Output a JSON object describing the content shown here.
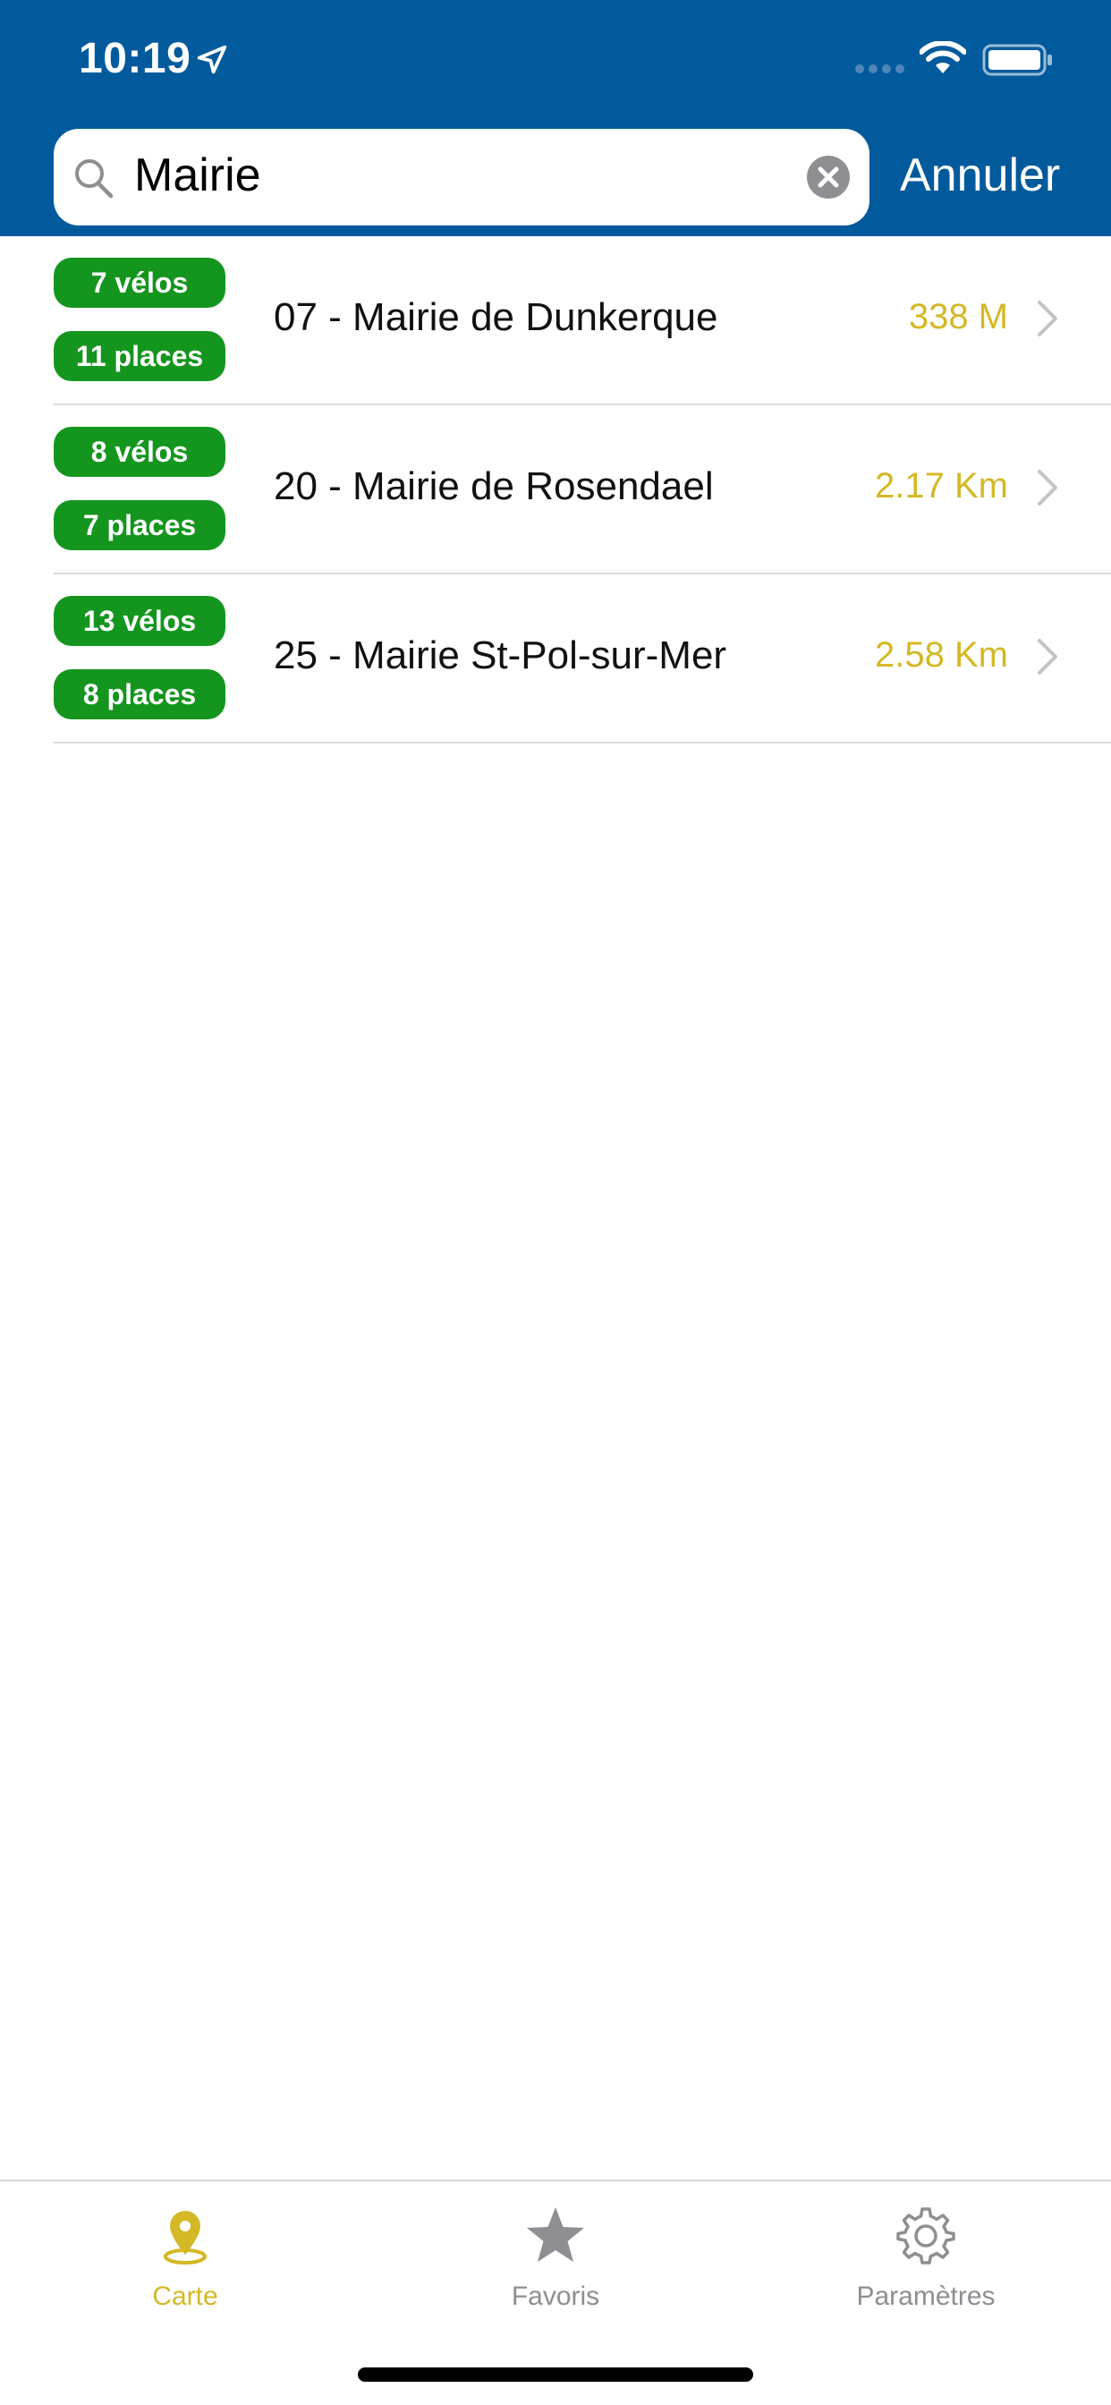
{
  "status_bar": {
    "time": "10:19"
  },
  "search": {
    "query": "Mairie",
    "cancel_label": "Annuler"
  },
  "stations": [
    {
      "bikes": "7 vélos",
      "places": "11 places",
      "name": "07 - Mairie de Dunkerque",
      "distance": "338 M"
    },
    {
      "bikes": "8 vélos",
      "places": "7 places",
      "name": "20 - Mairie de Rosendael",
      "distance": "2.17 Km"
    },
    {
      "bikes": "13 vélos",
      "places": "8 places",
      "name": "25 - Mairie St-Pol-sur-Mer",
      "distance": "2.58 Km"
    }
  ],
  "tabbar": {
    "tabs": [
      {
        "label": "Carte",
        "icon": "map-pin-icon",
        "active": true
      },
      {
        "label": "Favoris",
        "icon": "star-icon",
        "active": false
      },
      {
        "label": "Paramètres",
        "icon": "gear-icon",
        "active": false
      }
    ]
  },
  "colors": {
    "header_bg": "#005a9c",
    "badge_green": "#14961e",
    "accent_yellow": "#d4b826",
    "inactive_gray": "#8e8e93"
  }
}
